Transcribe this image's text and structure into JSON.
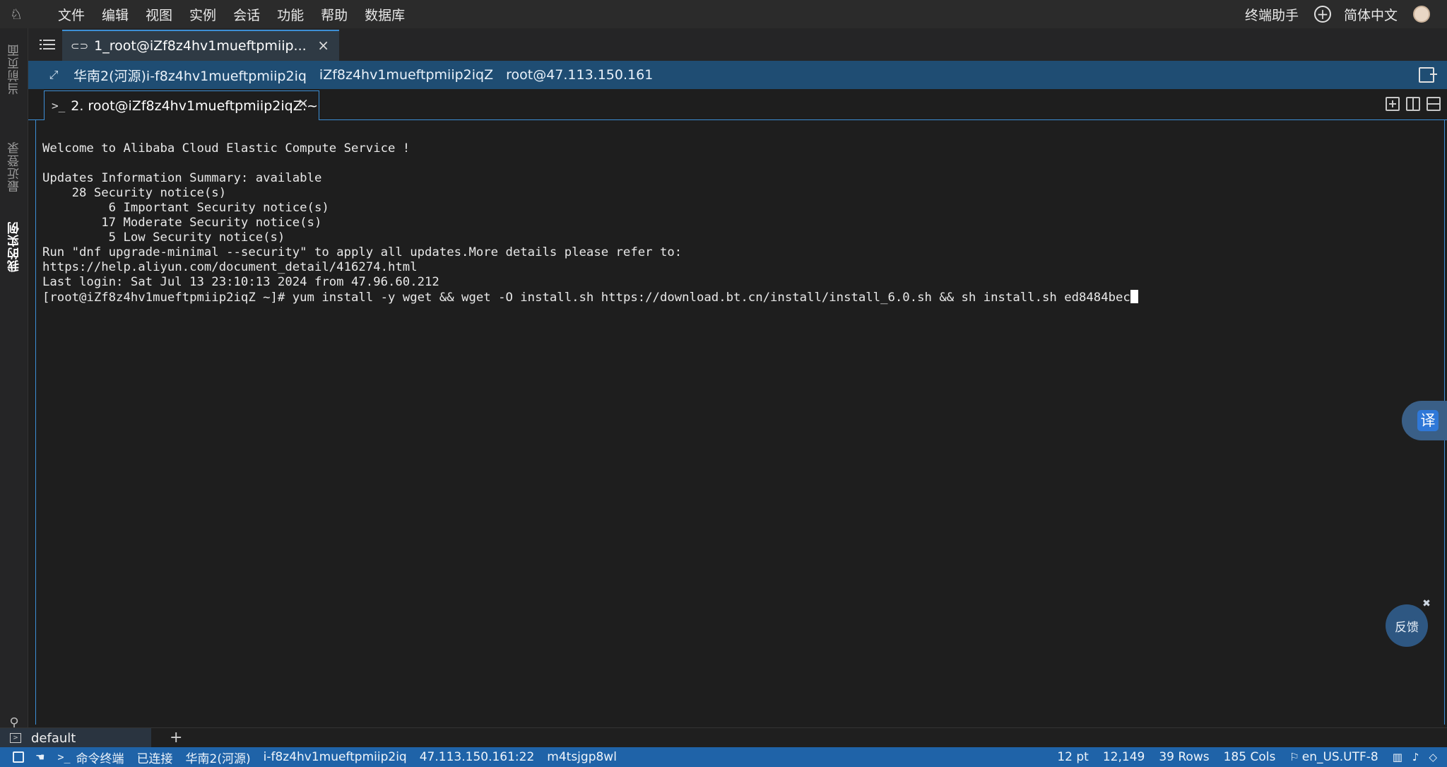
{
  "menu": {
    "items": [
      "文件",
      "编辑",
      "视图",
      "实例",
      "会话",
      "功能",
      "帮助",
      "数据库"
    ],
    "right": {
      "assistant": "终端助手",
      "language": "简体中文"
    }
  },
  "sidebar": {
    "tabs": [
      {
        "label": "当前页面",
        "icon": "refresh-icon"
      },
      {
        "label": "最近登录",
        "icon": "clock-icon"
      },
      {
        "label": "我的实例",
        "icon": "list-icon",
        "active": true
      }
    ]
  },
  "session_tab": {
    "label": "1_root@iZf8z4hv1mueftpmiip..."
  },
  "info_bar": {
    "region": "华南2(河源)i-f8z4hv1mueftpmiip2iq",
    "hostname": "iZf8z4hv1mueftpmiip2iqZ",
    "login": "root@47.113.150.161"
  },
  "terminal_tab": {
    "label": "2. root@iZf8z4hv1mueftpmiip2iqZ:~"
  },
  "terminal": {
    "lines": [
      "Welcome to Alibaba Cloud Elastic Compute Service !",
      "",
      "Updates Information Summary: available",
      "    28 Security notice(s)",
      "         6 Important Security notice(s)",
      "        17 Moderate Security notice(s)",
      "         5 Low Security notice(s)",
      "Run \"dnf upgrade-minimal --security\" to apply all updates.More details please refer to:",
      "https://help.aliyun.com/document_detail/416274.html",
      "Last login: Sat Jul 13 23:10:13 2024 from 47.96.60.212"
    ],
    "prompt": "[root@iZf8z4hv1mueftpmiip2iqZ ~]# ",
    "command": "yum install -y wget && wget -O install.sh https://download.bt.cn/install/install_6.0.sh && sh install.sh ed8484bec"
  },
  "floating": {
    "translate": "译",
    "feedback": "反馈"
  },
  "group": {
    "label": "default"
  },
  "status": {
    "left": [
      "命令终端",
      "已连接",
      "华南2(河源)",
      "i-f8z4hv1mueftpmiip2iq",
      "47.113.150.161:22",
      "m4tsjgp8wl"
    ],
    "font_size": "12 pt",
    "cursor_pos": "12,149",
    "rows": "39 Rows",
    "cols": "185 Cols",
    "encoding": "en_US.UTF-8"
  },
  "colors": {
    "accent": "#3d8fd6",
    "status_bar": "#1f63a8",
    "info_bar": "#1f4d73"
  }
}
